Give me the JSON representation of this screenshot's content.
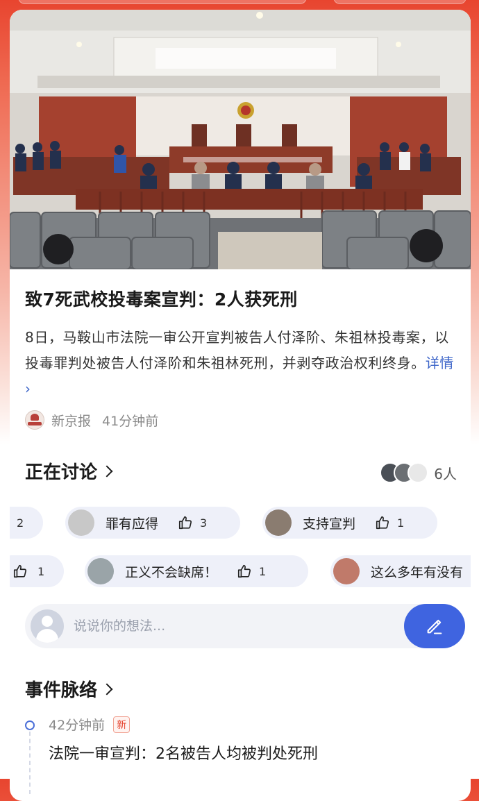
{
  "colors": {
    "accent_blue": "#3f64e0",
    "link_blue": "#3a63c8",
    "header_red": "#e8452f",
    "new_badge": "#e5422d"
  },
  "article": {
    "title": "致7死武校投毒案宣判：2人获死刑",
    "summary": "8日，马鞍山市法院一审公开宣判被告人付泽阶、朱祖林投毒案，以投毒罪判处被告人付泽阶和朱祖林死刑，并剥夺政治权利终身。",
    "detail_link": "详情 ›",
    "source_name": "新京报",
    "time": "41分钟前",
    "source_logo_icon": "newspaper-emblem-icon",
    "image_icon": "courtroom-photo"
  },
  "discussion": {
    "title": "正在讨论",
    "participant_count": "6人",
    "rows": [
      [
        {
          "text": "",
          "likes": "2",
          "like_icon": "thumbs-up-icon"
        },
        {
          "text": "罪有应得",
          "likes": "3",
          "like_icon": "thumbs-up-icon"
        },
        {
          "text": "支持宣判",
          "likes": "1",
          "like_icon": "thumbs-up-icon"
        }
      ],
      [
        {
          "text": "",
          "likes": "1",
          "like_icon": "thumbs-up-icon"
        },
        {
          "text": "正义不会缺席！",
          "likes": "1",
          "like_icon": "thumbs-up-icon"
        },
        {
          "text": "这么多年有没有",
          "likes": "",
          "like_icon": "thumbs-up-icon"
        }
      ]
    ]
  },
  "comment_input": {
    "placeholder": "说说你的想法...",
    "value": "",
    "button_icon": "pencil-icon"
  },
  "timeline": {
    "title": "事件脉络",
    "items": [
      {
        "time": "42分钟前",
        "badge": "新",
        "text": "法院一审宣判：2名被告人均被判处死刑"
      }
    ]
  }
}
